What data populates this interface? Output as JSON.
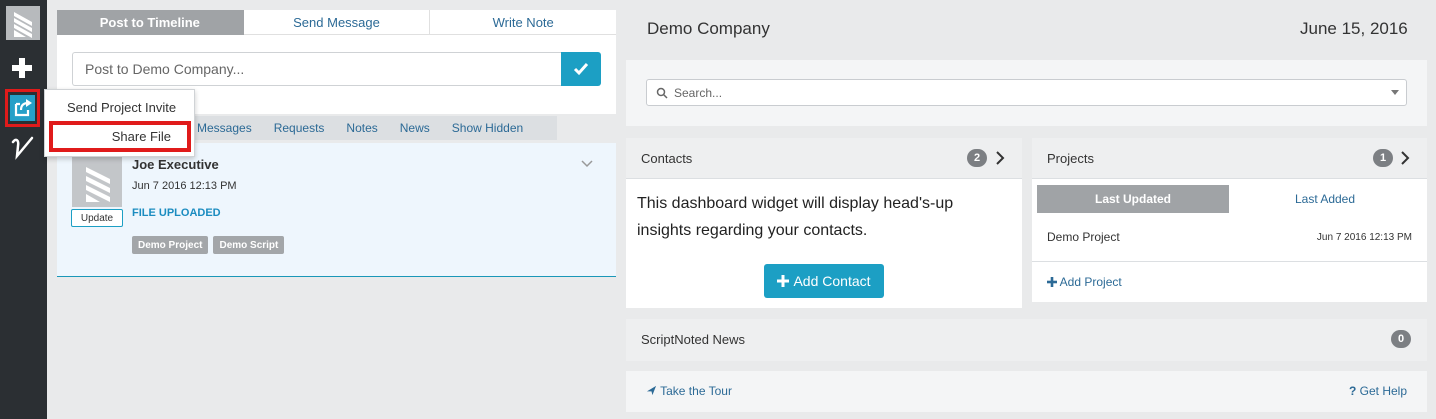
{
  "rail": {
    "icons": [
      "logo-icon",
      "plus-icon",
      "share-icon",
      "scriptnoted-v-icon"
    ]
  },
  "composer": {
    "tabs": [
      {
        "label": "Post to Timeline",
        "active": true
      },
      {
        "label": "Send Message",
        "active": false
      },
      {
        "label": "Write Note",
        "active": false
      }
    ],
    "input_placeholder": "Post to Demo Company...",
    "submit_icon": "checkmark-icon"
  },
  "popup_menu": {
    "items": [
      "Send Project Invite",
      "Share File"
    ]
  },
  "filters": [
    "Messages",
    "Requests",
    "Notes",
    "News",
    "Show Hidden"
  ],
  "feed_item": {
    "author": "Joe Executive",
    "date": "Jun 7 2016 12:13 PM",
    "status": "FILE UPLOADED",
    "update_label": "Update",
    "tags": [
      "Demo Project",
      "Demo Script"
    ]
  },
  "header": {
    "company": "Demo Company",
    "date": "June 15, 2016"
  },
  "search": {
    "placeholder": "Search..."
  },
  "contacts": {
    "title": "Contacts",
    "count": "2",
    "body": "This dashboard widget will display head's-up insights regarding your contacts.",
    "add_label": "Add Contact"
  },
  "projects": {
    "title": "Projects",
    "count": "1",
    "tabs": [
      {
        "label": "Last Updated",
        "active": true
      },
      {
        "label": "Last Added",
        "active": false
      }
    ],
    "rows": [
      {
        "name": "Demo Project",
        "date": "Jun 7 2016 12:13 PM"
      }
    ],
    "add_label": "Add Project"
  },
  "news": {
    "title": "ScriptNoted News",
    "count": "0"
  },
  "footer": {
    "tour_label": "Take the Tour",
    "help_label": "Get Help"
  },
  "colors": {
    "accent": "#1c9fc4",
    "highlight": "#e01b1b",
    "rail": "#2b2f33"
  }
}
